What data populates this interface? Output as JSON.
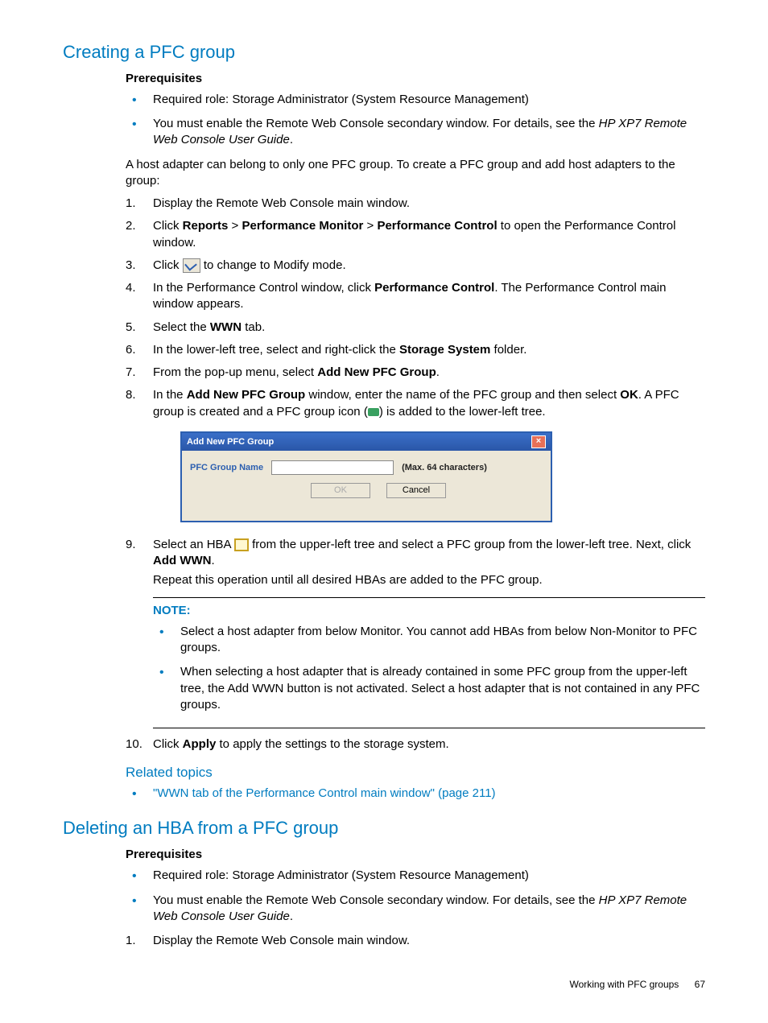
{
  "section1": {
    "heading": "Creating a PFC group",
    "prereq_title": "Prerequisites",
    "prereqs": [
      "Required role: Storage Administrator (System Resource Management)",
      {
        "pre": "You must enable the Remote Web Console secondary window. For details, see the ",
        "it": "HP XP7 Remote Web Console User Guide",
        "post": "."
      }
    ],
    "intro": "A host adapter can belong to only one PFC group. To create a PFC group and add host adapters to the group:",
    "steps": {
      "s1": "Display the Remote Web Console main window.",
      "s2": {
        "a": "Click ",
        "b1": "Reports",
        "m1": " > ",
        "b2": "Performance Monitor",
        "m2": " > ",
        "b3": "Performance Control",
        "c": " to open the Performance Control window."
      },
      "s3": {
        "a": "Click ",
        "b": " to change to Modify mode."
      },
      "s4": {
        "a": "In the Performance Control window, click ",
        "b": "Performance Control",
        "c": ". The Performance Control main window appears."
      },
      "s5": {
        "a": "Select the ",
        "b": "WWN",
        "c": " tab."
      },
      "s6": {
        "a": "In the lower-left tree, select and right-click the ",
        "b": "Storage System",
        "c": " folder."
      },
      "s7": {
        "a": "From the pop-up menu, select ",
        "b": "Add New PFC Group",
        "c": "."
      },
      "s8": {
        "a": "In the ",
        "b": "Add New PFC Group",
        "c": " window, enter the name of the PFC group and then select ",
        "d": "OK",
        "e": ". A PFC group is created and a PFC group icon (",
        "f": ") is added to the lower-left tree."
      },
      "s9": {
        "a": "Select an HBA ",
        "b": " from the upper-left tree and select a PFC group from the lower-left tree. Next, click ",
        "c": "Add WWN",
        "d": ".",
        "repeat": "Repeat this operation until all desired HBAs are added to the PFC group."
      },
      "s10": {
        "a": "Click ",
        "b": "Apply",
        "c": " to apply the settings to the storage system."
      }
    },
    "dialog": {
      "title": "Add New PFC Group",
      "label": "PFC Group Name",
      "hint": "(Max. 64 characters)",
      "ok": "OK",
      "cancel": "Cancel"
    },
    "note": {
      "label": "NOTE:",
      "n1": "Select a host adapter from below Monitor. You cannot add HBAs from below Non-Monitor to PFC groups.",
      "n2": "When selecting a host adapter that is already contained in some PFC group from the upper-left tree, the Add WWN button is not activated. Select a host adapter that is not contained in any PFC groups."
    },
    "related_title": "Related topics",
    "related_link": "\"WWN tab of the Performance Control main window\" (page 211)"
  },
  "section2": {
    "heading": "Deleting an HBA from a PFC group",
    "prereq_title": "Prerequisites",
    "prereqs": [
      "Required role: Storage Administrator (System Resource Management)",
      {
        "pre": "You must enable the Remote Web Console secondary window. For details, see the ",
        "it": "HP XP7 Remote Web Console User Guide",
        "post": "."
      }
    ],
    "s1": "Display the Remote Web Console main window."
  },
  "footer": {
    "text": "Working with PFC groups",
    "page": "67"
  }
}
